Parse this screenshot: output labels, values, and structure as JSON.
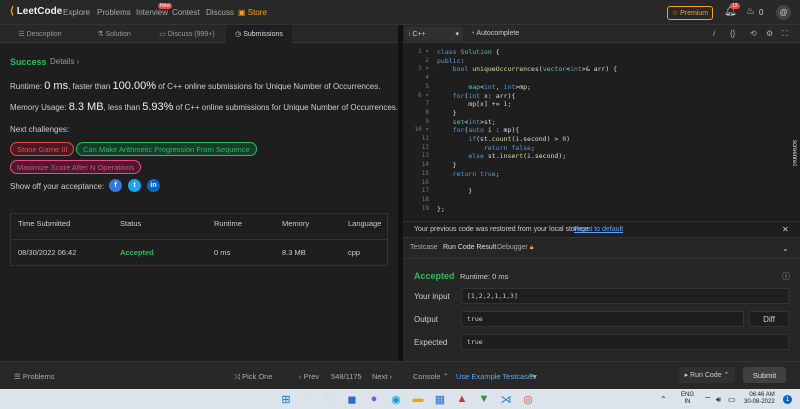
{
  "nav": {
    "logo": "LeetCode",
    "links": [
      "Explore",
      "Problems",
      "Interview",
      "Contest",
      "Discuss"
    ],
    "new_badge": "New",
    "store": "Store",
    "premium": "Premium",
    "bell_count": "12",
    "streak": "0",
    "avatar_initial": "@"
  },
  "left_tabs": [
    "Description",
    "Solution",
    "Discuss (999+)",
    "Submissions"
  ],
  "result": {
    "status": "Success",
    "details": "Details",
    "runtime_pre": "Runtime: ",
    "runtime_val": "0 ms",
    "runtime_mid": ", faster than ",
    "runtime_pct": "100.00%",
    "runtime_post": " of C++ online submissions for Unique Number of Occurrences.",
    "mem_pre": "Memory Usage: ",
    "mem_val": "8.3 MB",
    "mem_mid": ", less than ",
    "mem_pct": "5.93%",
    "mem_post": " of C++ online submissions for Unique Number of Occurrences."
  },
  "next_challenges_label": "Next challenges:",
  "challenges": [
    "Stone Game III",
    "Can Make Arithmetic Progression From Sequence",
    "Maximize Score After N Operations"
  ],
  "show_off": "Show off your acceptance:",
  "social": [
    "f",
    "t",
    "in"
  ],
  "submissions": {
    "headers": [
      "Time Submitted",
      "Status",
      "Runtime",
      "Memory",
      "Language"
    ],
    "row": [
      "08/30/2022 06:42",
      "Accepted",
      "0 ms",
      "8.3 MB",
      "cpp"
    ]
  },
  "editor": {
    "language": "C++",
    "autocomplete": "Autocomplete",
    "side_note": "screenrec"
  },
  "restore": {
    "message": "Your previous code was restored from your local storage.",
    "link": "Reset to default"
  },
  "result_tabs": [
    "Testcase",
    "Run Code Result",
    "Debugger"
  ],
  "run": {
    "status": "Accepted",
    "runtime": "Runtime: 0 ms",
    "input_label": "Your input",
    "input": "[1,2,2,1,1,3]",
    "output_label": "Output",
    "output": "true",
    "expected_label": "Expected",
    "expected": "true",
    "diff": "Diff"
  },
  "bottom": {
    "problems": "Problems",
    "pick_one": "Pick One",
    "prev": "Prev",
    "counter": "548/1175",
    "next": "Next",
    "console": "Console",
    "use_example": "Use Example Testcases",
    "run_code": "Run Code",
    "submit": "Submit"
  },
  "taskbar": {
    "lang_line1": "ENG",
    "lang_line2": "IN",
    "time": "06:46 AM",
    "date": "30-08-2022",
    "notif": "1"
  },
  "colors": {
    "accent": "#ffa116",
    "success": "#2cbb5d",
    "link": "#5aa5ff"
  }
}
